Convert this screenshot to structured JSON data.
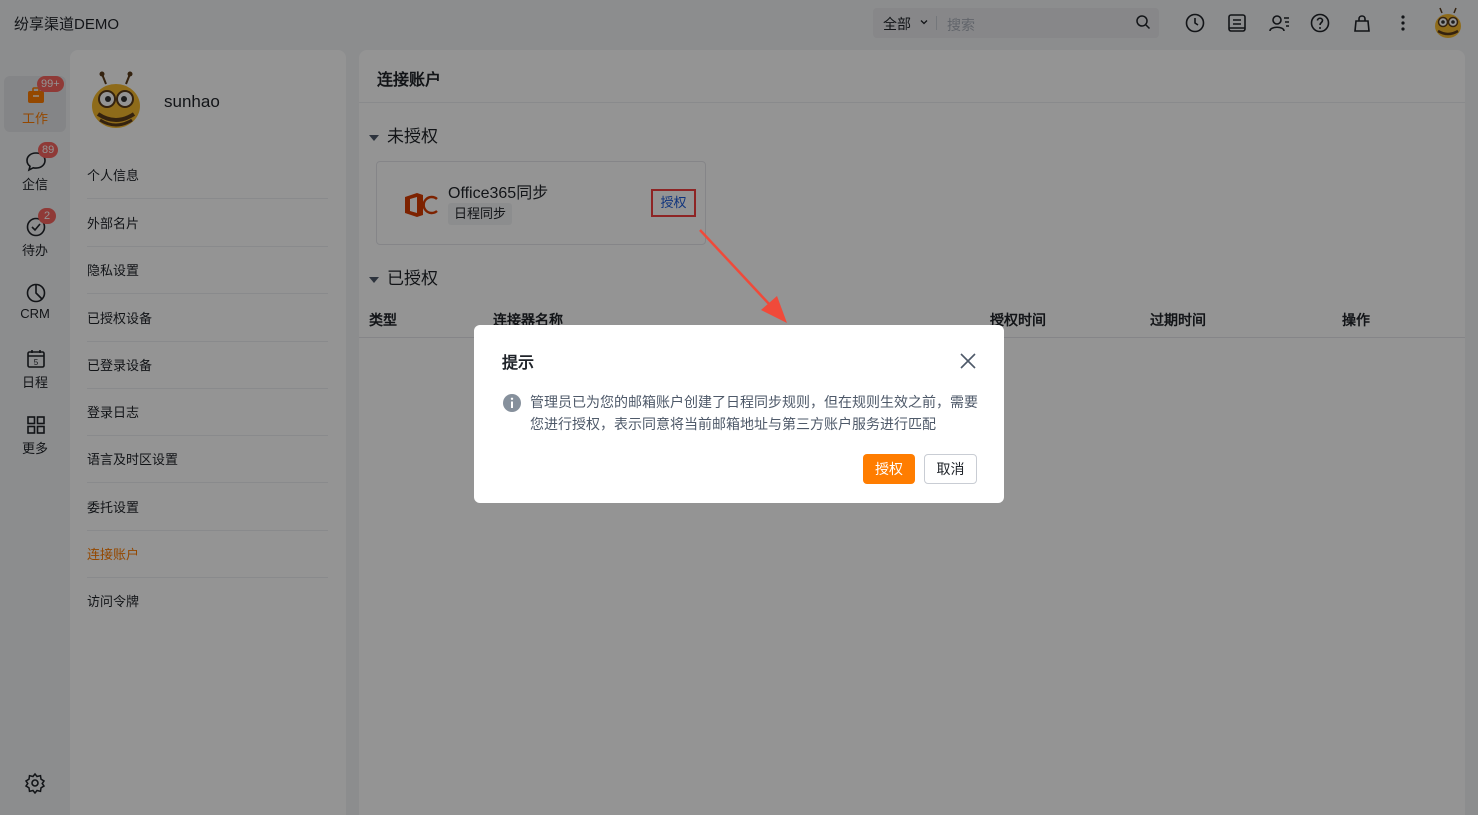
{
  "app": {
    "title": "纷享渠道DEMO"
  },
  "search": {
    "scope": "全部",
    "placeholder": "搜索"
  },
  "topbar_icons": [
    "clock-icon",
    "report-icon",
    "contacts-icon",
    "help-icon",
    "bag-icon",
    "more-icon",
    "avatar"
  ],
  "nav": {
    "items": [
      {
        "label": "工作",
        "badge": "99+",
        "icon": "briefcase-icon",
        "active": true
      },
      {
        "label": "企信",
        "badge": "89",
        "icon": "chat-icon"
      },
      {
        "label": "待办",
        "badge": "2",
        "icon": "check-circle-icon"
      },
      {
        "label": "CRM",
        "icon": "pie-chart-icon"
      },
      {
        "label": "日程",
        "icon": "calendar-icon"
      },
      {
        "label": "更多",
        "icon": "grid-icon"
      }
    ]
  },
  "profile": {
    "username": "sunhao",
    "menu": [
      "个人信息",
      "外部名片",
      "隐私设置",
      "已授权设备",
      "已登录设备",
      "登录日志",
      "语言及时区设置",
      "委托设置",
      "连接账户",
      "访问令牌"
    ],
    "active_item": "连接账户"
  },
  "main": {
    "title": "连接账户",
    "unauthorized": {
      "heading": "未授权",
      "card": {
        "title": "Office365同步",
        "tag": "日程同步",
        "action": "授权"
      }
    },
    "authorized": {
      "heading": "已授权",
      "columns": [
        "类型",
        "连接器名称",
        "授权时间",
        "过期时间",
        "操作"
      ]
    }
  },
  "dialog": {
    "title": "提示",
    "message": "管理员已为您的邮箱账户创建了日程同步规则，但在规则生效之前，需要您进行授权，表示同意将当前邮箱地址与第三方账户服务进行匹配",
    "ok": "授权",
    "cancel": "取消"
  },
  "colors": {
    "accent": "#ff7d00",
    "link": "#1d5bd8",
    "highlight": "#f53f3f",
    "badge": "#f76560"
  }
}
